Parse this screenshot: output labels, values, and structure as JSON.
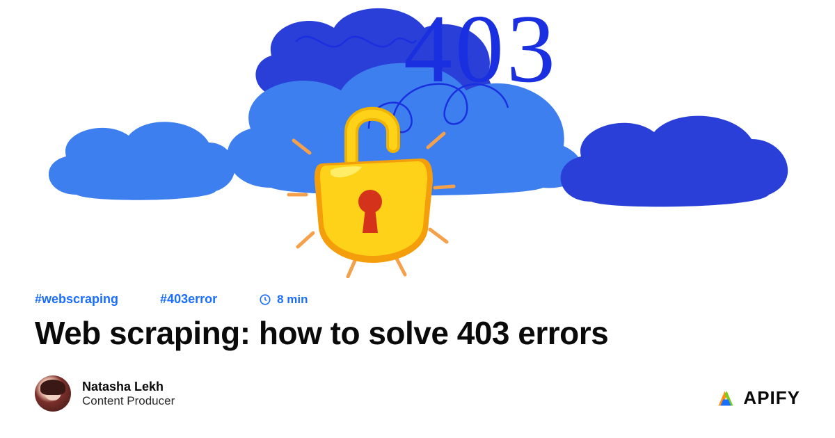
{
  "hero": {
    "error_code": "403"
  },
  "meta": {
    "tags": [
      "#webscraping",
      "#403error"
    ],
    "read_time": "8 min"
  },
  "article": {
    "title": "Web scraping: how to solve 403 errors"
  },
  "author": {
    "name": "Natasha Lekh",
    "role": "Content Producer"
  },
  "brand": {
    "name": "APIFY"
  },
  "icons": {
    "clock": "clock-icon",
    "lock": "lock-icon",
    "cloud": "cloud-icon"
  }
}
